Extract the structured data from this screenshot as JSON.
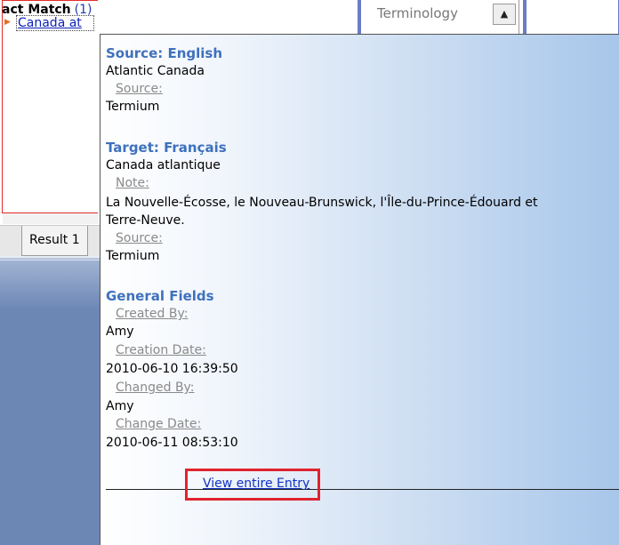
{
  "results": {
    "heading": "act Match",
    "count": "(1)",
    "items": [
      {
        "label": "Canada at"
      }
    ]
  },
  "tabs": {
    "result_tab": "Result 1"
  },
  "terminology": {
    "selected": "Terminology"
  },
  "entry": {
    "source_heading": "Source: English",
    "source_term": "Atlantic Canada",
    "source_source_label": "Source:",
    "source_source_value": "Termium",
    "target_heading": "Target: Français",
    "target_term": "Canada atlantique",
    "target_note_label": "Note:",
    "target_note_line1": "La Nouvelle-Écosse, le Nouveau-Brunswick, l'Île-du-Prince-Édouard et",
    "target_note_line2": "Terre-Neuve.",
    "target_source_label": "Source:",
    "target_source_value": "Termium",
    "general_heading": "General Fields",
    "created_by_label": "Created By:",
    "created_by_value": "Amy",
    "creation_date_label": "Creation Date:",
    "creation_date_value": "2010-06-10 16:39:50",
    "changed_by_label": "Changed By:",
    "changed_by_value": "Amy",
    "change_date_label": "Change Date:",
    "change_date_value": "2010-06-11 08:53:10",
    "view_entry_link": "View entire Entry"
  },
  "colors": {
    "highlight_red": "#e0232f",
    "heading_blue": "#3e71bd",
    "link_blue": "#1132c6"
  }
}
